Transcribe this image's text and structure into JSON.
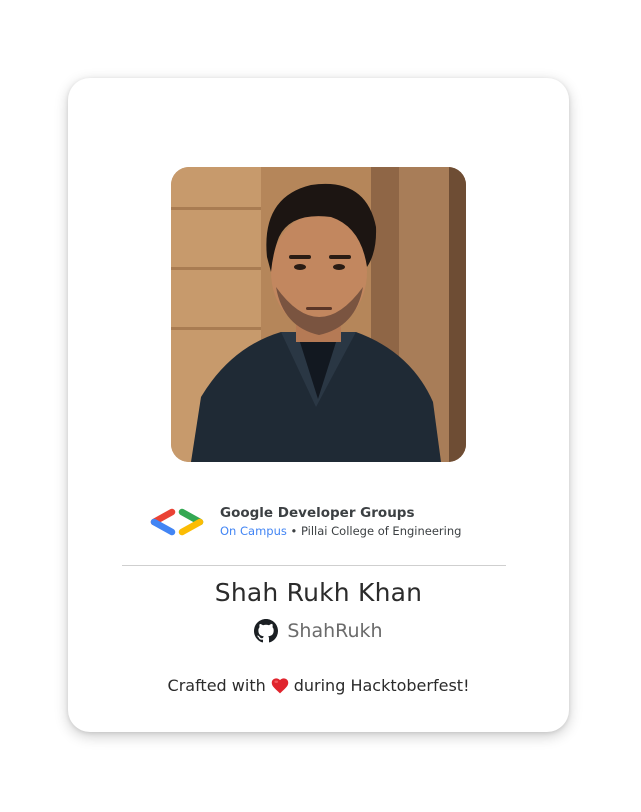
{
  "profile": {
    "photo_icon": "profile-photo",
    "name": "Shah Rukh Khan",
    "github_icon": "github-icon",
    "github_handle": "ShahRukh"
  },
  "brand": {
    "logo_icon": "gdg-logo-icon",
    "title": "Google Developer Groups",
    "campus": "On Campus",
    "separator": " • ",
    "college": "Pillai College of Engineering",
    "colors": {
      "blue": "#4285f4",
      "red": "#ea4335",
      "green": "#34a853",
      "yellow": "#fbbc04"
    }
  },
  "footer": {
    "prefix": "Crafted with",
    "heart_icon": "heart-icon",
    "suffix": "during Hacktoberfest!"
  }
}
